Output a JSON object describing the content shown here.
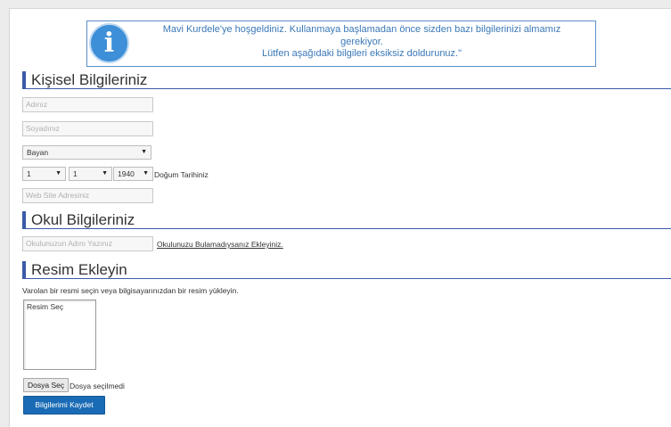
{
  "notice": {
    "icon": "info-icon",
    "icon_glyph": "i",
    "line1": "Mavi Kurdele'ye hoşgeldiniz. Kullanmaya başlamadan önce sizden bazı bilgilerinizi almamız",
    "line2": "gerekiyor.",
    "line3": "Lütfen aşağıdaki bilgileri eksiksiz doldurunuz.\""
  },
  "personal": {
    "title": "Kişisel Bilgileriniz",
    "first_name_placeholder": "Adınız",
    "last_name_placeholder": "Soyadınız",
    "gender": "Bayan",
    "birth_day": "1",
    "birth_month": "1",
    "birth_year": "1940",
    "birth_label": "Doğum Tarihiniz",
    "website_placeholder": "Web Site Adresiniz"
  },
  "school": {
    "title": "Okul Bilgileriniz",
    "school_placeholder": "Okulunuzun Adını Yazınız",
    "not_found_link": "Okulunuzu Bulamadıysanız Ekleyiniz."
  },
  "photo": {
    "title": "Resim Ekleyin",
    "description": "Varolan bir resmi seçin veya bilgisayarınızdan bir resim yükleyin.",
    "list_item": "Resim Seç",
    "file_button": "Dosya Seç",
    "file_status": "Dosya seçilmedi"
  },
  "submit_label": "Bilgilerimi Kaydet",
  "colors": {
    "accent": "#3b5aa8",
    "button": "#1a6bb5",
    "notice_text": "#3a78b8"
  }
}
